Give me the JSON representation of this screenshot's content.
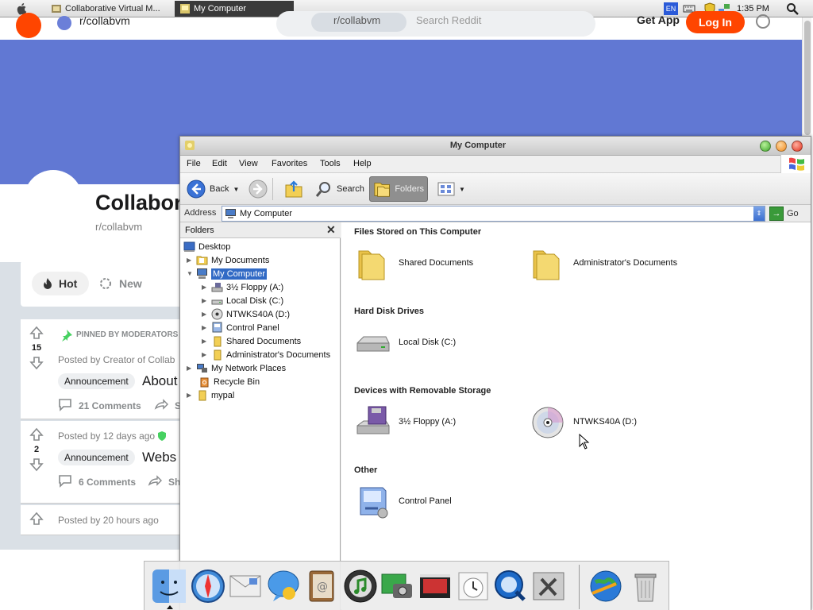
{
  "taskbar": {
    "tabs": [
      {
        "label": "Collaborative Virtual M..."
      },
      {
        "label": "My Computer"
      }
    ],
    "lang": "EN",
    "clock": "1:35 PM"
  },
  "reddit": {
    "subreddit": "r/collabvm",
    "search_chip": "r/collabvm",
    "search_placeholder": "Search Reddit",
    "get_app": "Get App",
    "login": "Log In",
    "community_title": "Collabor",
    "community_handle": "r/collabvm",
    "sort": {
      "hot": "Hot",
      "new": "New"
    },
    "posts": [
      {
        "votes": "15",
        "meta": "PINNED BY MODERATORS",
        "posted": "Posted by  Creator of Collab",
        "flair": "Announcement",
        "title": "About",
        "comments": "21 Comments",
        "share": "S"
      },
      {
        "votes": "2",
        "meta": "",
        "posted": "Posted by 12 days ago",
        "flair": "Announcement",
        "title": "Webs",
        "comments": "6 Comments",
        "share": "Sh"
      },
      {
        "votes": "",
        "meta": "",
        "posted": "Posted by 20 hours ago",
        "flair": "",
        "title": "",
        "comments": "",
        "share": ""
      }
    ]
  },
  "explorer": {
    "title": "My Computer",
    "menu": [
      "File",
      "Edit",
      "View",
      "Favorites",
      "Tools",
      "Help"
    ],
    "toolbar": {
      "back": "Back",
      "search": "Search",
      "folders": "Folders"
    },
    "address_label": "Address",
    "address_value": "My Computer",
    "go": "Go",
    "folders_header": "Folders",
    "tree": [
      {
        "label": "Desktop",
        "level": 0
      },
      {
        "label": "My Documents",
        "level": 1
      },
      {
        "label": "My Computer",
        "level": 1,
        "selected": true
      },
      {
        "label": "3½ Floppy (A:)",
        "level": 2
      },
      {
        "label": "Local Disk (C:)",
        "level": 2
      },
      {
        "label": "NTWKS40A (D:)",
        "level": 2
      },
      {
        "label": "Control Panel",
        "level": 2
      },
      {
        "label": "Shared Documents",
        "level": 2
      },
      {
        "label": "Administrator's Documents",
        "level": 2
      },
      {
        "label": "My Network Places",
        "level": 1
      },
      {
        "label": "Recycle Bin",
        "level": 1
      },
      {
        "label": "mypal",
        "level": 1
      }
    ],
    "groups": [
      {
        "title": "Files Stored on This Computer",
        "items": [
          "Shared Documents",
          "Administrator's Documents"
        ]
      },
      {
        "title": "Hard Disk Drives",
        "items": [
          "Local Disk (C:)"
        ]
      },
      {
        "title": "Devices with Removable Storage",
        "items": [
          "3½ Floppy (A:)",
          "NTWKS40A (D:)"
        ]
      },
      {
        "title": "Other",
        "items": [
          "Control Panel"
        ]
      }
    ]
  },
  "dock": {
    "icons": [
      "finder-icon",
      "safari-icon",
      "mail-icon",
      "ichat-icon",
      "address-book-icon",
      "itunes-icon",
      "iphoto-icon",
      "imovie-icon",
      "ical-icon",
      "quicktime-icon",
      "system-preferences-icon",
      "network-globe-icon",
      "trash-icon"
    ]
  },
  "colors": {
    "reddit_orange": "#ff4500",
    "reddit_banner": "#6178d3",
    "selection": "#316ac5"
  }
}
